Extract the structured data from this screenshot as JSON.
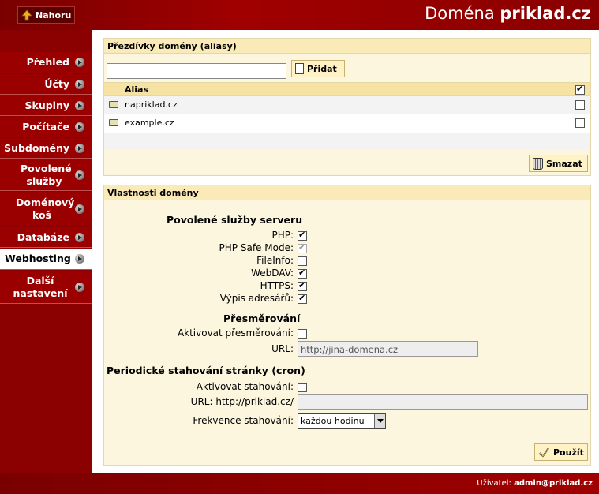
{
  "header": {
    "up_label": "Nahoru",
    "title_prefix": "Doména",
    "title_domain": "priklad.cz"
  },
  "sidebar": {
    "items": [
      {
        "label": "Přehled"
      },
      {
        "label": "Účty"
      },
      {
        "label": "Skupiny"
      },
      {
        "label": "Počítače"
      },
      {
        "label": "Subdomény"
      },
      {
        "label": "Povolené služby"
      },
      {
        "label": "Doménový koš"
      },
      {
        "label": "Databáze"
      },
      {
        "label": "Webhosting",
        "active": true
      },
      {
        "label": "Další nastavení"
      }
    ]
  },
  "aliases_panel": {
    "title": "Přezdívky domény (aliasy)",
    "input_value": "",
    "add_label": "Přidat",
    "column_alias": "Alias",
    "rows": [
      {
        "name": "napriklad.cz",
        "checked": false
      },
      {
        "name": "example.cz",
        "checked": false
      }
    ],
    "header_checked": true,
    "delete_label": "Smazat"
  },
  "props_panel": {
    "title": "Vlastnosti domény",
    "services_title": "Povolené služby serveru",
    "services": [
      {
        "label": "PHP:",
        "checked": true,
        "disabled": false
      },
      {
        "label": "PHP Safe Mode:",
        "checked": true,
        "disabled": true
      },
      {
        "label": "FileInfo:",
        "checked": false,
        "disabled": false
      },
      {
        "label": "WebDAV:",
        "checked": true,
        "disabled": false
      },
      {
        "label": "HTTPS:",
        "checked": true,
        "disabled": false
      },
      {
        "label": "Výpis adresářů:",
        "checked": true,
        "disabled": false
      }
    ],
    "redirect_title": "Přesměrování",
    "redirect_activate_label": "Aktivovat přesměrování:",
    "redirect_url_label": "URL:",
    "redirect_url_value": "http://jina-domena.cz",
    "cron_title": "Periodické stahování stránky (cron)",
    "cron_activate_label": "Aktivovat stahování:",
    "cron_url_label": "URL: http://priklad.cz/",
    "cron_url_value": "",
    "cron_freq_label": "Frekvence stahování:",
    "cron_freq_value": "každou hodinu",
    "apply_label": "Použít"
  },
  "footer": {
    "user_label": "Uživatel:",
    "user_value": "admin@priklad.cz"
  }
}
